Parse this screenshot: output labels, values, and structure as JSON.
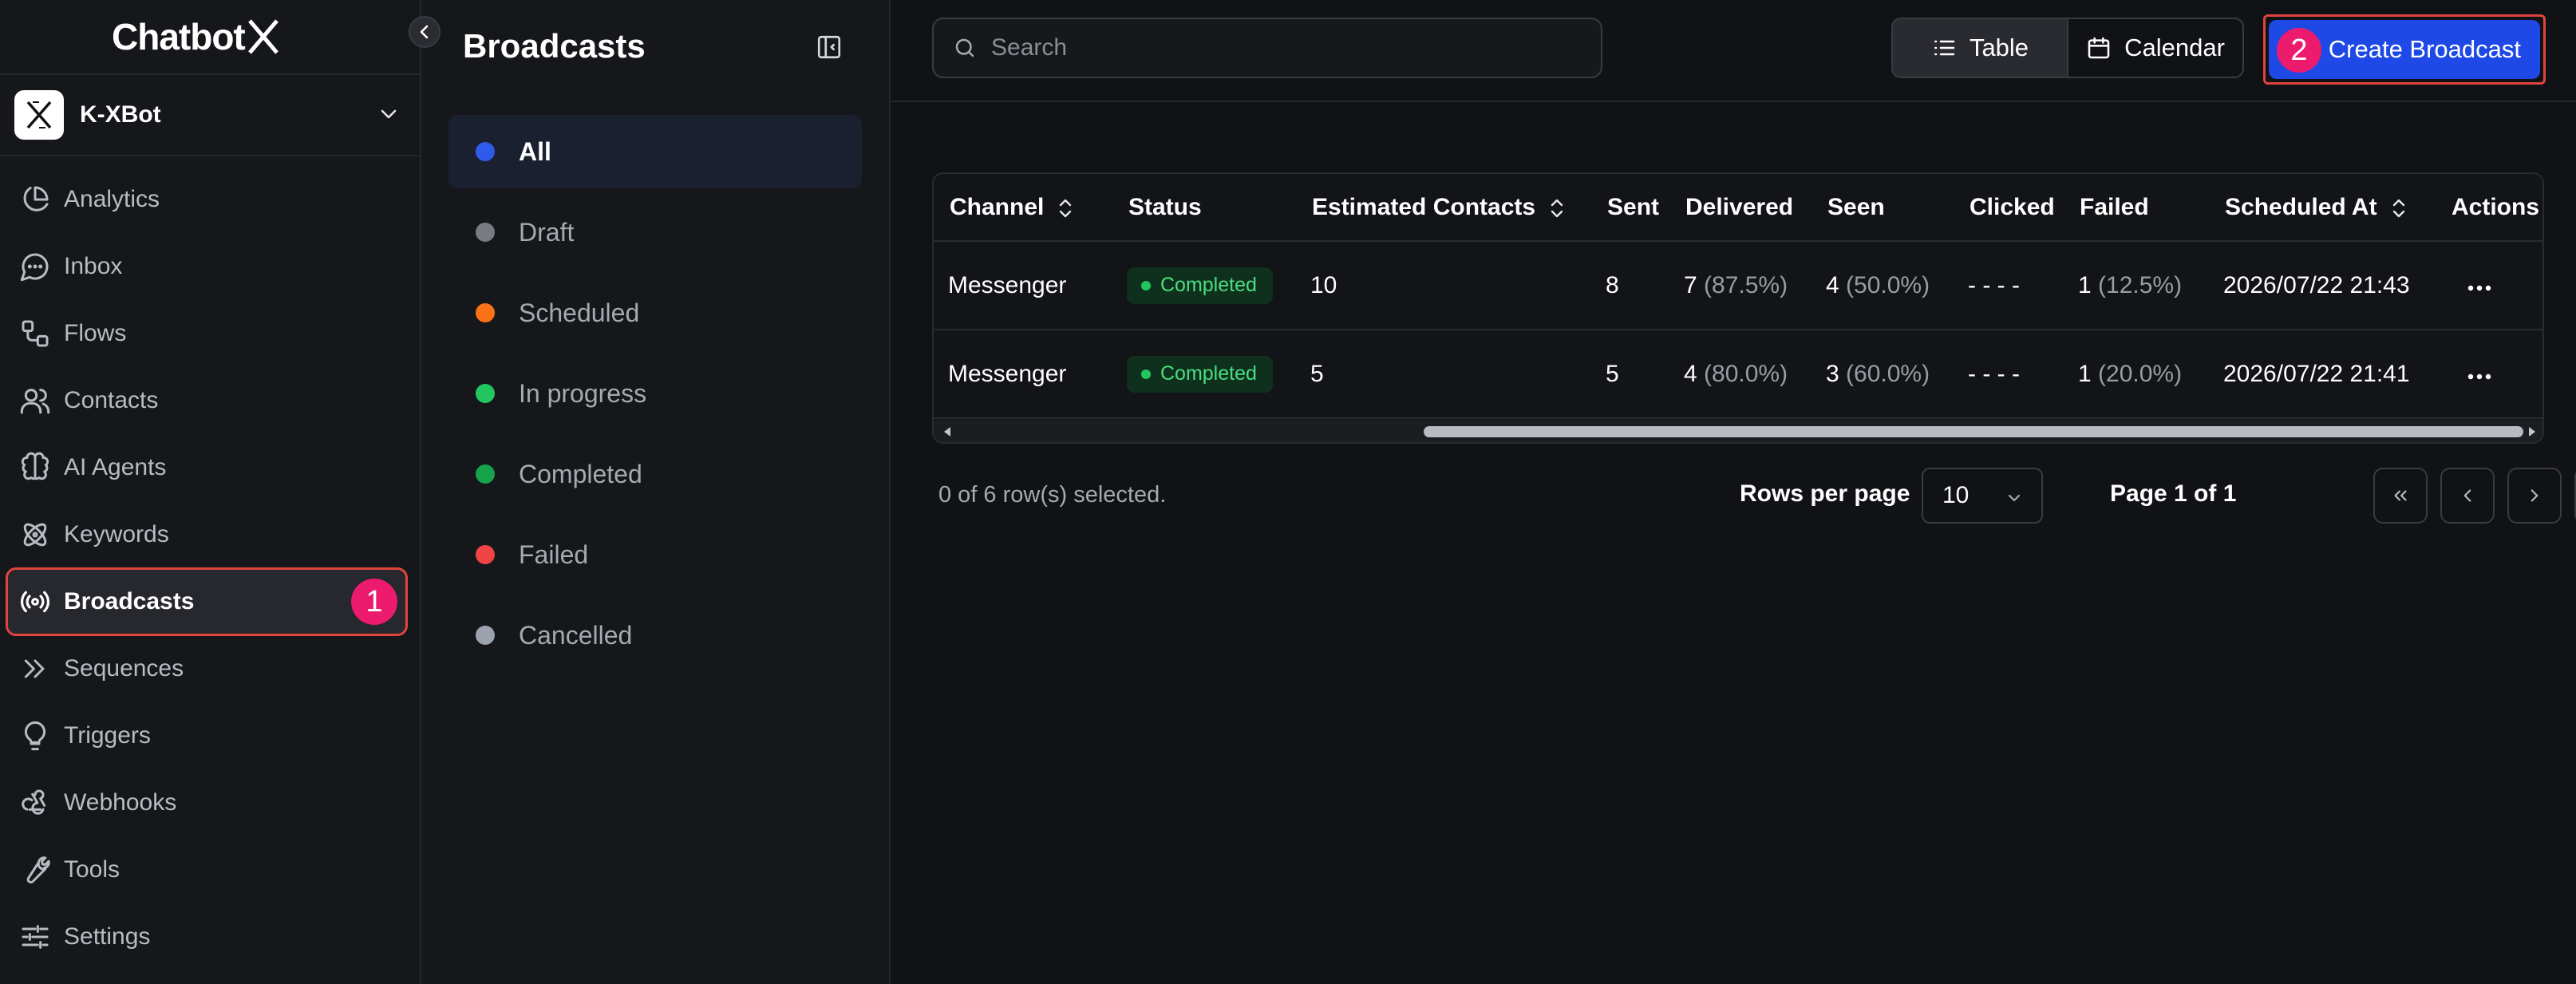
{
  "app": {
    "logo_text": "Chatbot"
  },
  "workspace": {
    "name": "K-XBot"
  },
  "nav": {
    "items": [
      {
        "label": "Analytics"
      },
      {
        "label": "Inbox"
      },
      {
        "label": "Flows"
      },
      {
        "label": "Contacts"
      },
      {
        "label": "AI Agents"
      },
      {
        "label": "Keywords"
      },
      {
        "label": "Broadcasts",
        "active": true,
        "badge": "1"
      },
      {
        "label": "Sequences"
      },
      {
        "label": "Triggers"
      },
      {
        "label": "Webhooks"
      },
      {
        "label": "Tools"
      },
      {
        "label": "Settings"
      }
    ]
  },
  "status_panel": {
    "title": "Broadcasts",
    "items": [
      {
        "label": "All",
        "color": "#2f5bea",
        "active": true
      },
      {
        "label": "Draft",
        "color": "#7a7b80"
      },
      {
        "label": "Scheduled",
        "color": "#f97316"
      },
      {
        "label": "In progress",
        "color": "#22c55e"
      },
      {
        "label": "Completed",
        "color": "#16a34a"
      },
      {
        "label": "Failed",
        "color": "#ef4444"
      },
      {
        "label": "Cancelled",
        "color": "#9ca3af"
      }
    ]
  },
  "toolbar": {
    "search_placeholder": "Search",
    "table_label": "Table",
    "calendar_label": "Calendar",
    "create_label": "Create Broadcast",
    "create_badge": "2"
  },
  "table": {
    "columns": [
      "Channel",
      "Status",
      "Estimated Contacts",
      "Sent",
      "Delivered",
      "Seen",
      "Clicked",
      "Failed",
      "Scheduled At",
      "Actions"
    ],
    "rows": [
      {
        "channel": "Messenger",
        "status": "Completed",
        "estimated": "10",
        "sent": "8",
        "delivered": "7",
        "delivered_pct": "(87.5%)",
        "seen": "4",
        "seen_pct": "(50.0%)",
        "clicked": "- - - -",
        "failed": "1",
        "failed_pct": "(12.5%)",
        "scheduled": "2026/07/22 21:43"
      },
      {
        "channel": "Messenger",
        "status": "Completed",
        "estimated": "5",
        "sent": "5",
        "delivered": "4",
        "delivered_pct": "(80.0%)",
        "seen": "3",
        "seen_pct": "(60.0%)",
        "clicked": "- - - -",
        "failed": "1",
        "failed_pct": "(20.0%)",
        "scheduled": "2026/07/22 21:41"
      }
    ]
  },
  "footer": {
    "selection_text": "0 of 6 row(s) selected.",
    "rows_per_page_label": "Rows per page",
    "rows_per_page_value": "10",
    "page_label": "Page 1 of 1"
  },
  "colors": {
    "accent": "#1f49e6",
    "highlight_border": "#e0443e",
    "badge": "#ec1b6e"
  }
}
